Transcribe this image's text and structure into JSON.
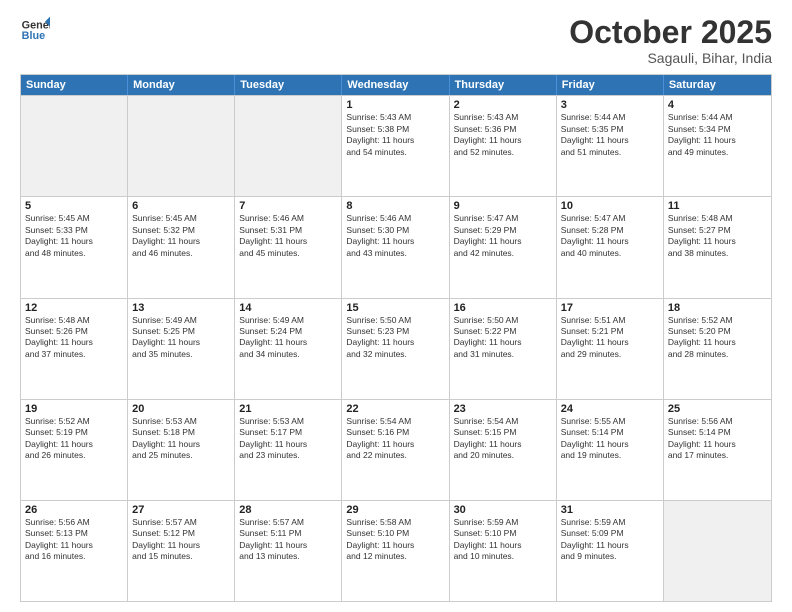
{
  "logo": {
    "line1": "General",
    "line2": "Blue"
  },
  "header": {
    "month": "October 2025",
    "location": "Sagauli, Bihar, India"
  },
  "weekdays": [
    "Sunday",
    "Monday",
    "Tuesday",
    "Wednesday",
    "Thursday",
    "Friday",
    "Saturday"
  ],
  "rows": [
    [
      {
        "day": "",
        "info": ""
      },
      {
        "day": "",
        "info": ""
      },
      {
        "day": "",
        "info": ""
      },
      {
        "day": "1",
        "info": "Sunrise: 5:43 AM\nSunset: 5:38 PM\nDaylight: 11 hours\nand 54 minutes."
      },
      {
        "day": "2",
        "info": "Sunrise: 5:43 AM\nSunset: 5:36 PM\nDaylight: 11 hours\nand 52 minutes."
      },
      {
        "day": "3",
        "info": "Sunrise: 5:44 AM\nSunset: 5:35 PM\nDaylight: 11 hours\nand 51 minutes."
      },
      {
        "day": "4",
        "info": "Sunrise: 5:44 AM\nSunset: 5:34 PM\nDaylight: 11 hours\nand 49 minutes."
      }
    ],
    [
      {
        "day": "5",
        "info": "Sunrise: 5:45 AM\nSunset: 5:33 PM\nDaylight: 11 hours\nand 48 minutes."
      },
      {
        "day": "6",
        "info": "Sunrise: 5:45 AM\nSunset: 5:32 PM\nDaylight: 11 hours\nand 46 minutes."
      },
      {
        "day": "7",
        "info": "Sunrise: 5:46 AM\nSunset: 5:31 PM\nDaylight: 11 hours\nand 45 minutes."
      },
      {
        "day": "8",
        "info": "Sunrise: 5:46 AM\nSunset: 5:30 PM\nDaylight: 11 hours\nand 43 minutes."
      },
      {
        "day": "9",
        "info": "Sunrise: 5:47 AM\nSunset: 5:29 PM\nDaylight: 11 hours\nand 42 minutes."
      },
      {
        "day": "10",
        "info": "Sunrise: 5:47 AM\nSunset: 5:28 PM\nDaylight: 11 hours\nand 40 minutes."
      },
      {
        "day": "11",
        "info": "Sunrise: 5:48 AM\nSunset: 5:27 PM\nDaylight: 11 hours\nand 38 minutes."
      }
    ],
    [
      {
        "day": "12",
        "info": "Sunrise: 5:48 AM\nSunset: 5:26 PM\nDaylight: 11 hours\nand 37 minutes."
      },
      {
        "day": "13",
        "info": "Sunrise: 5:49 AM\nSunset: 5:25 PM\nDaylight: 11 hours\nand 35 minutes."
      },
      {
        "day": "14",
        "info": "Sunrise: 5:49 AM\nSunset: 5:24 PM\nDaylight: 11 hours\nand 34 minutes."
      },
      {
        "day": "15",
        "info": "Sunrise: 5:50 AM\nSunset: 5:23 PM\nDaylight: 11 hours\nand 32 minutes."
      },
      {
        "day": "16",
        "info": "Sunrise: 5:50 AM\nSunset: 5:22 PM\nDaylight: 11 hours\nand 31 minutes."
      },
      {
        "day": "17",
        "info": "Sunrise: 5:51 AM\nSunset: 5:21 PM\nDaylight: 11 hours\nand 29 minutes."
      },
      {
        "day": "18",
        "info": "Sunrise: 5:52 AM\nSunset: 5:20 PM\nDaylight: 11 hours\nand 28 minutes."
      }
    ],
    [
      {
        "day": "19",
        "info": "Sunrise: 5:52 AM\nSunset: 5:19 PM\nDaylight: 11 hours\nand 26 minutes."
      },
      {
        "day": "20",
        "info": "Sunrise: 5:53 AM\nSunset: 5:18 PM\nDaylight: 11 hours\nand 25 minutes."
      },
      {
        "day": "21",
        "info": "Sunrise: 5:53 AM\nSunset: 5:17 PM\nDaylight: 11 hours\nand 23 minutes."
      },
      {
        "day": "22",
        "info": "Sunrise: 5:54 AM\nSunset: 5:16 PM\nDaylight: 11 hours\nand 22 minutes."
      },
      {
        "day": "23",
        "info": "Sunrise: 5:54 AM\nSunset: 5:15 PM\nDaylight: 11 hours\nand 20 minutes."
      },
      {
        "day": "24",
        "info": "Sunrise: 5:55 AM\nSunset: 5:14 PM\nDaylight: 11 hours\nand 19 minutes."
      },
      {
        "day": "25",
        "info": "Sunrise: 5:56 AM\nSunset: 5:14 PM\nDaylight: 11 hours\nand 17 minutes."
      }
    ],
    [
      {
        "day": "26",
        "info": "Sunrise: 5:56 AM\nSunset: 5:13 PM\nDaylight: 11 hours\nand 16 minutes."
      },
      {
        "day": "27",
        "info": "Sunrise: 5:57 AM\nSunset: 5:12 PM\nDaylight: 11 hours\nand 15 minutes."
      },
      {
        "day": "28",
        "info": "Sunrise: 5:57 AM\nSunset: 5:11 PM\nDaylight: 11 hours\nand 13 minutes."
      },
      {
        "day": "29",
        "info": "Sunrise: 5:58 AM\nSunset: 5:10 PM\nDaylight: 11 hours\nand 12 minutes."
      },
      {
        "day": "30",
        "info": "Sunrise: 5:59 AM\nSunset: 5:10 PM\nDaylight: 11 hours\nand 10 minutes."
      },
      {
        "day": "31",
        "info": "Sunrise: 5:59 AM\nSunset: 5:09 PM\nDaylight: 11 hours\nand 9 minutes."
      },
      {
        "day": "",
        "info": ""
      }
    ]
  ]
}
